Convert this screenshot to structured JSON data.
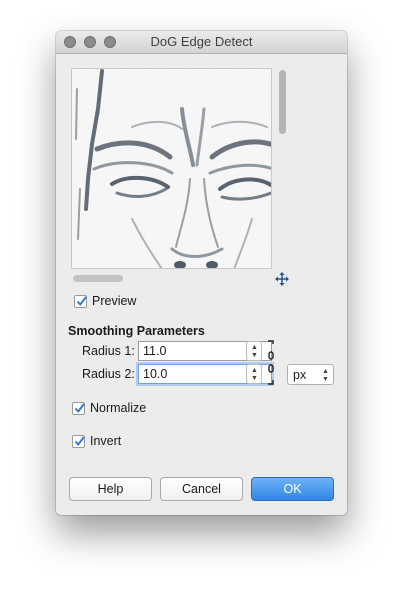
{
  "window": {
    "title": "DoG Edge Detect"
  },
  "preview": {
    "checkbox_label": "Preview",
    "checked": true
  },
  "smoothing": {
    "section_title": "Smoothing Parameters",
    "radius1": {
      "label": "Radius 1:",
      "value": "11.0"
    },
    "radius2": {
      "label": "Radius 2:",
      "value": "10.0"
    },
    "unit": "px",
    "chain_linked": true
  },
  "options": {
    "normalize": {
      "label": "Normalize",
      "checked": true
    },
    "invert": {
      "label": "Invert",
      "checked": true
    }
  },
  "buttons": {
    "help": "Help",
    "cancel": "Cancel",
    "ok": "OK"
  },
  "colors": {
    "accent": "#3b8fea",
    "checkbox": "#3478d0"
  }
}
